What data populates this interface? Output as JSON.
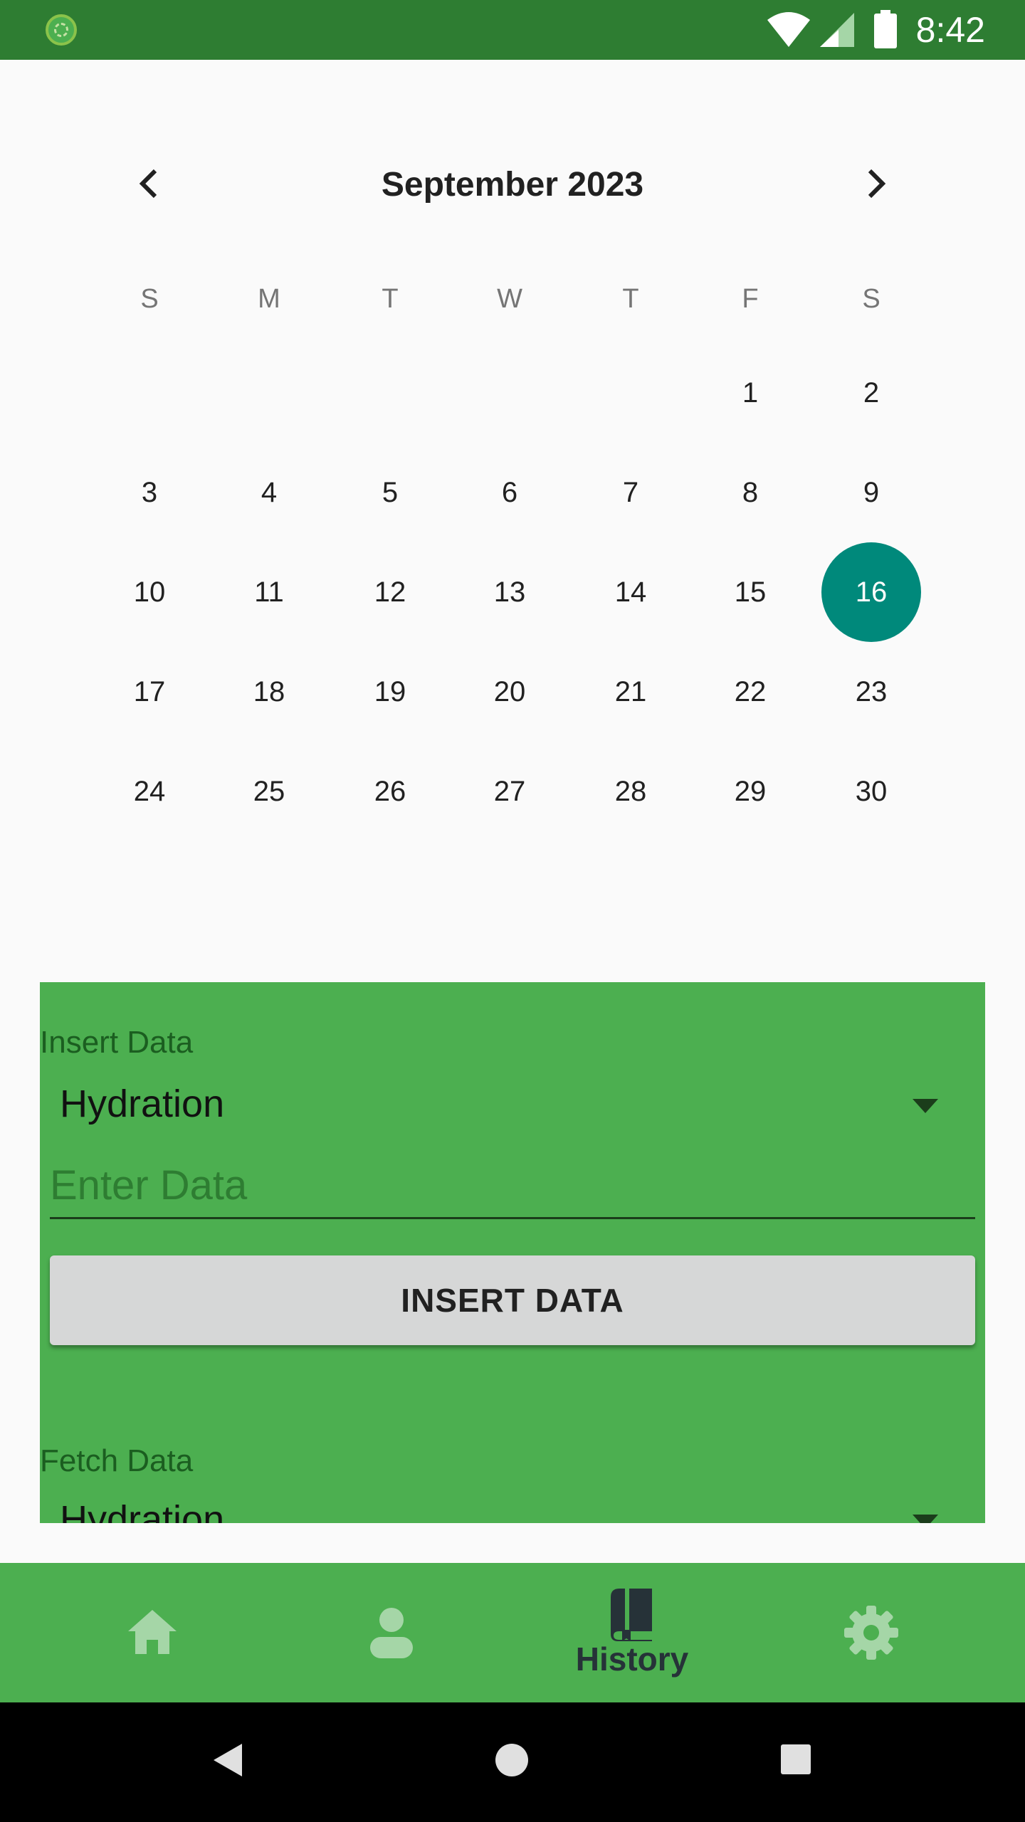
{
  "status_bar": {
    "time": "8:42"
  },
  "calendar": {
    "month_title": "September 2023",
    "weekdays": [
      "S",
      "M",
      "T",
      "W",
      "T",
      "F",
      "S"
    ],
    "days": [
      "1",
      "2",
      "3",
      "4",
      "5",
      "6",
      "7",
      "8",
      "9",
      "10",
      "11",
      "12",
      "13",
      "14",
      "15",
      "16",
      "17",
      "18",
      "19",
      "20",
      "21",
      "22",
      "23",
      "24",
      "25",
      "26",
      "27",
      "28",
      "29",
      "30"
    ],
    "selected_day": "16",
    "accent_color": "#00897b"
  },
  "insert_section": {
    "label": "Insert Data",
    "dropdown_value": "Hydration",
    "input_placeholder": "Enter Data",
    "button_label": "INSERT DATA"
  },
  "fetch_section": {
    "label": "Fetch Data",
    "dropdown_value": "Hydration"
  },
  "bottom_nav": {
    "items": [
      {
        "icon": "home-icon"
      },
      {
        "icon": "person-icon"
      },
      {
        "icon": "book-icon",
        "label": "History",
        "selected": true
      },
      {
        "icon": "gear-icon"
      }
    ],
    "background_color": "#4caf50"
  },
  "theme": {
    "status_bar_color": "#2e7d32",
    "panel_color": "#4caf50"
  }
}
